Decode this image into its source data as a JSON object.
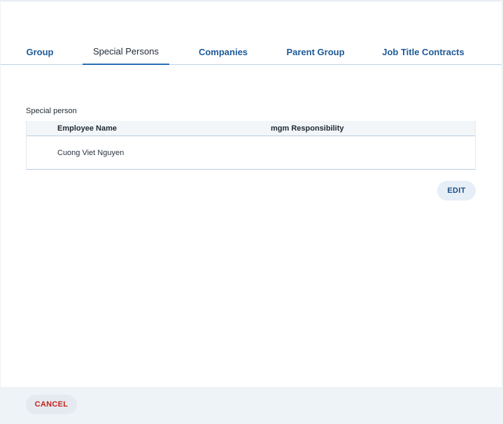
{
  "tabs": [
    {
      "label": "Group",
      "active": false
    },
    {
      "label": "Special Persons",
      "active": true
    },
    {
      "label": "Companies",
      "active": false
    },
    {
      "label": "Parent Group",
      "active": false
    },
    {
      "label": "Job Title Contracts",
      "active": false
    }
  ],
  "special_person": {
    "section_label": "Special person",
    "columns": [
      "Employee Name",
      "mgm Responsibility"
    ],
    "rows": [
      {
        "employee_name": "Cuong Viet Nguyen",
        "mgm_responsibility": ""
      }
    ]
  },
  "actions": {
    "edit_label": "EDIT",
    "cancel_label": "CANCEL"
  },
  "colors": {
    "accent": "#1d5a98",
    "tab_underline": "#2a6db5",
    "cancel_text": "#c4231b",
    "footer_bg": "#eef3f8"
  }
}
